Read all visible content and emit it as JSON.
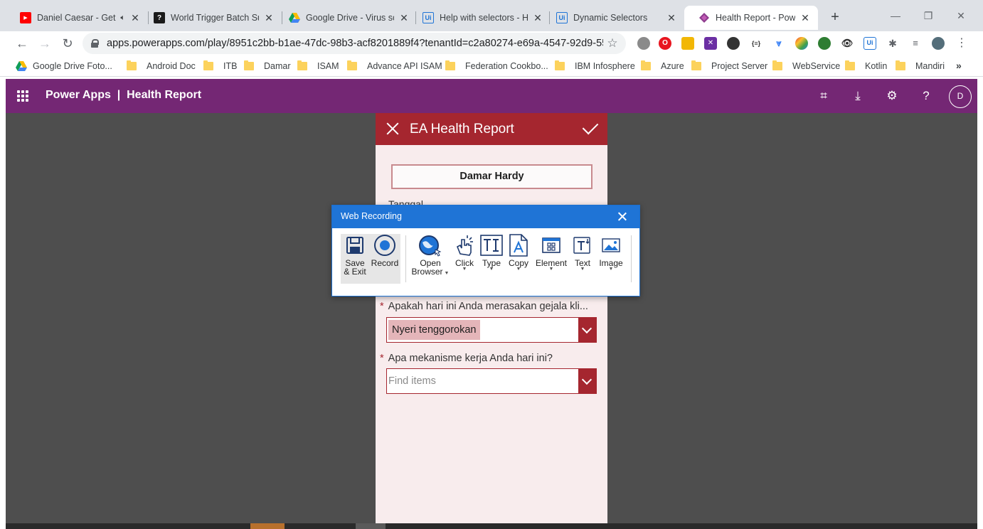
{
  "browser": {
    "tabs": [
      {
        "title": "Daniel Caesar - Get",
        "icon": "youtube-icon",
        "audio": true,
        "active": false
      },
      {
        "title": "World Trigger Batch Sub",
        "icon": "site-favicon",
        "active": false
      },
      {
        "title": "Google Drive - Virus sca",
        "icon": "google-drive-icon",
        "active": false
      },
      {
        "title": "Help with selectors - He",
        "icon": "uipath-icon",
        "active": false
      },
      {
        "title": "Dynamic Selectors",
        "icon": "uipath-icon",
        "active": false
      },
      {
        "title": "Health Report - Power A",
        "icon": "powerapps-icon",
        "active": true
      }
    ],
    "url": "apps.powerapps.com/play/8951c2bb-b1ae-47dc-98b3-acf8201889f4?tenantId=c2a80274-e69a-4547-92d9-55...",
    "bookmarks": [
      "Google Drive Foto...",
      "Android Doc",
      "ITB",
      "Damar",
      "ISAM",
      "Advance API ISAM",
      "Federation Cookbo...",
      "IBM Infosphere",
      "Azure",
      "Project Server",
      "WebService",
      "Kotlin",
      "Mandiri"
    ]
  },
  "header": {
    "title": "Power Apps  |  Health Report",
    "avatar_initial": "D"
  },
  "form": {
    "title": "EA Health Report",
    "name_value": "Damar Hardy",
    "tanggal_label": "Tanggal",
    "q1": {
      "label": "Apakah hari ini Anda merasakan gejala kli...",
      "selected": "Nyeri tenggorokan"
    },
    "q2": {
      "label": "Apa mekanisme kerja Anda hari ini?",
      "placeholder": "Find items"
    },
    "required_mark": "*"
  },
  "recorder": {
    "title": "Web Recording",
    "tools": [
      {
        "id": "save",
        "label_line1": "Save",
        "label_line2": "& Exit",
        "icon": "save-icon"
      },
      {
        "id": "record",
        "label_line1": "Record",
        "icon": "record-icon"
      },
      {
        "id": "open-browser",
        "label_line1": "Open",
        "label_line2": "Browser",
        "icon": "globe-icon"
      },
      {
        "id": "click",
        "label_line1": "Click",
        "icon": "click-icon"
      },
      {
        "id": "type",
        "label_line1": "Type",
        "icon": "type-icon"
      },
      {
        "id": "copy",
        "label_line1": "Copy",
        "icon": "copy-icon"
      },
      {
        "id": "element",
        "label_line1": "Element",
        "icon": "element-icon"
      },
      {
        "id": "text",
        "label_line1": "Text",
        "icon": "text-icon"
      },
      {
        "id": "image",
        "label_line1": "Image",
        "icon": "image-icon"
      }
    ]
  },
  "colors": {
    "powerapps_purple": "#742774",
    "form_red": "#a5262f",
    "form_bg": "#f8eced",
    "recorder_blue": "#1f74d6",
    "canvas_gray": "#4e4e4e"
  }
}
